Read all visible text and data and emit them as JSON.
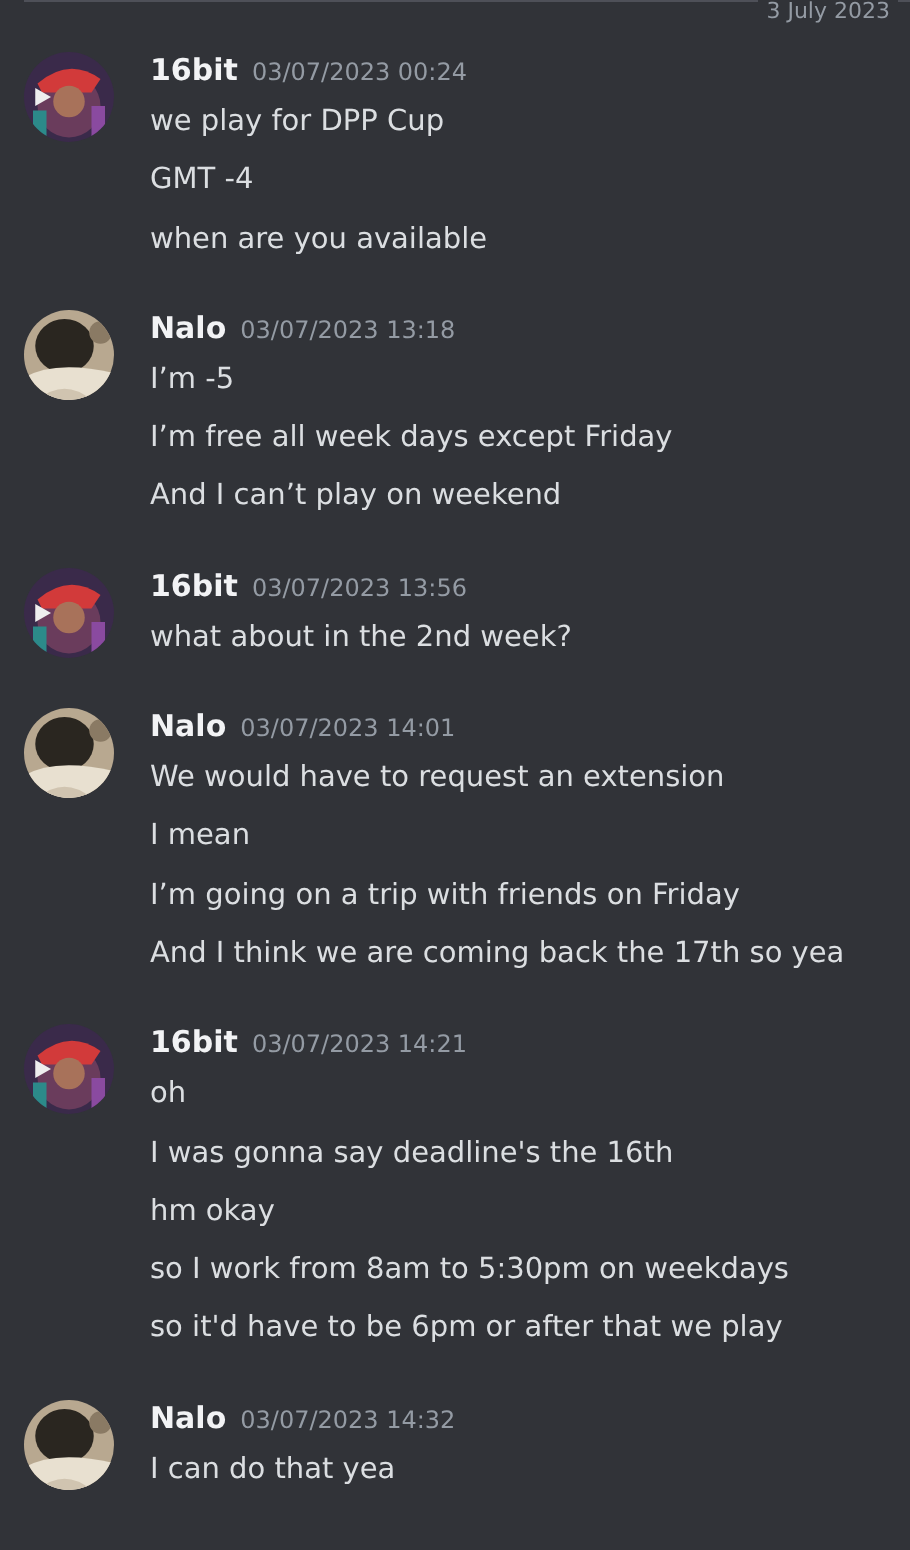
{
  "date_divider": {
    "label": "3 July 2023"
  },
  "messages": [
    {
      "author": "16bit",
      "timestamp": "03/07/2023 00:24",
      "kind": "red",
      "lines": [
        "we play for DPP Cup",
        "GMT -4",
        "when are you available"
      ]
    },
    {
      "author": "Nalo",
      "timestamp": "03/07/2023 13:18",
      "kind": "pale",
      "lines": [
        "I’m -5",
        "I’m free all week days except Friday",
        "And I can’t play on weekend"
      ]
    },
    {
      "author": "16bit",
      "timestamp": "03/07/2023 13:56",
      "kind": "red",
      "lines": [
        "what about in the 2nd week?"
      ]
    },
    {
      "author": "Nalo",
      "timestamp": "03/07/2023 14:01",
      "kind": "pale",
      "lines": [
        "We would have to request an extension",
        "I mean",
        "I’m going on a trip with friends on Friday",
        "And I think we are coming back the 17th so yea"
      ]
    },
    {
      "author": "16bit",
      "timestamp": "03/07/2023 14:21",
      "kind": "red",
      "lines": [
        "oh",
        "I was gonna say deadline's the 16th",
        "hm okay",
        "so I work from 8am to 5:30pm on weekdays",
        "so it'd have to be 6pm or after that we play"
      ]
    },
    {
      "author": "Nalo",
      "timestamp": "03/07/2023 14:32",
      "kind": "pale",
      "lines": [
        "I can do that yea"
      ]
    }
  ]
}
